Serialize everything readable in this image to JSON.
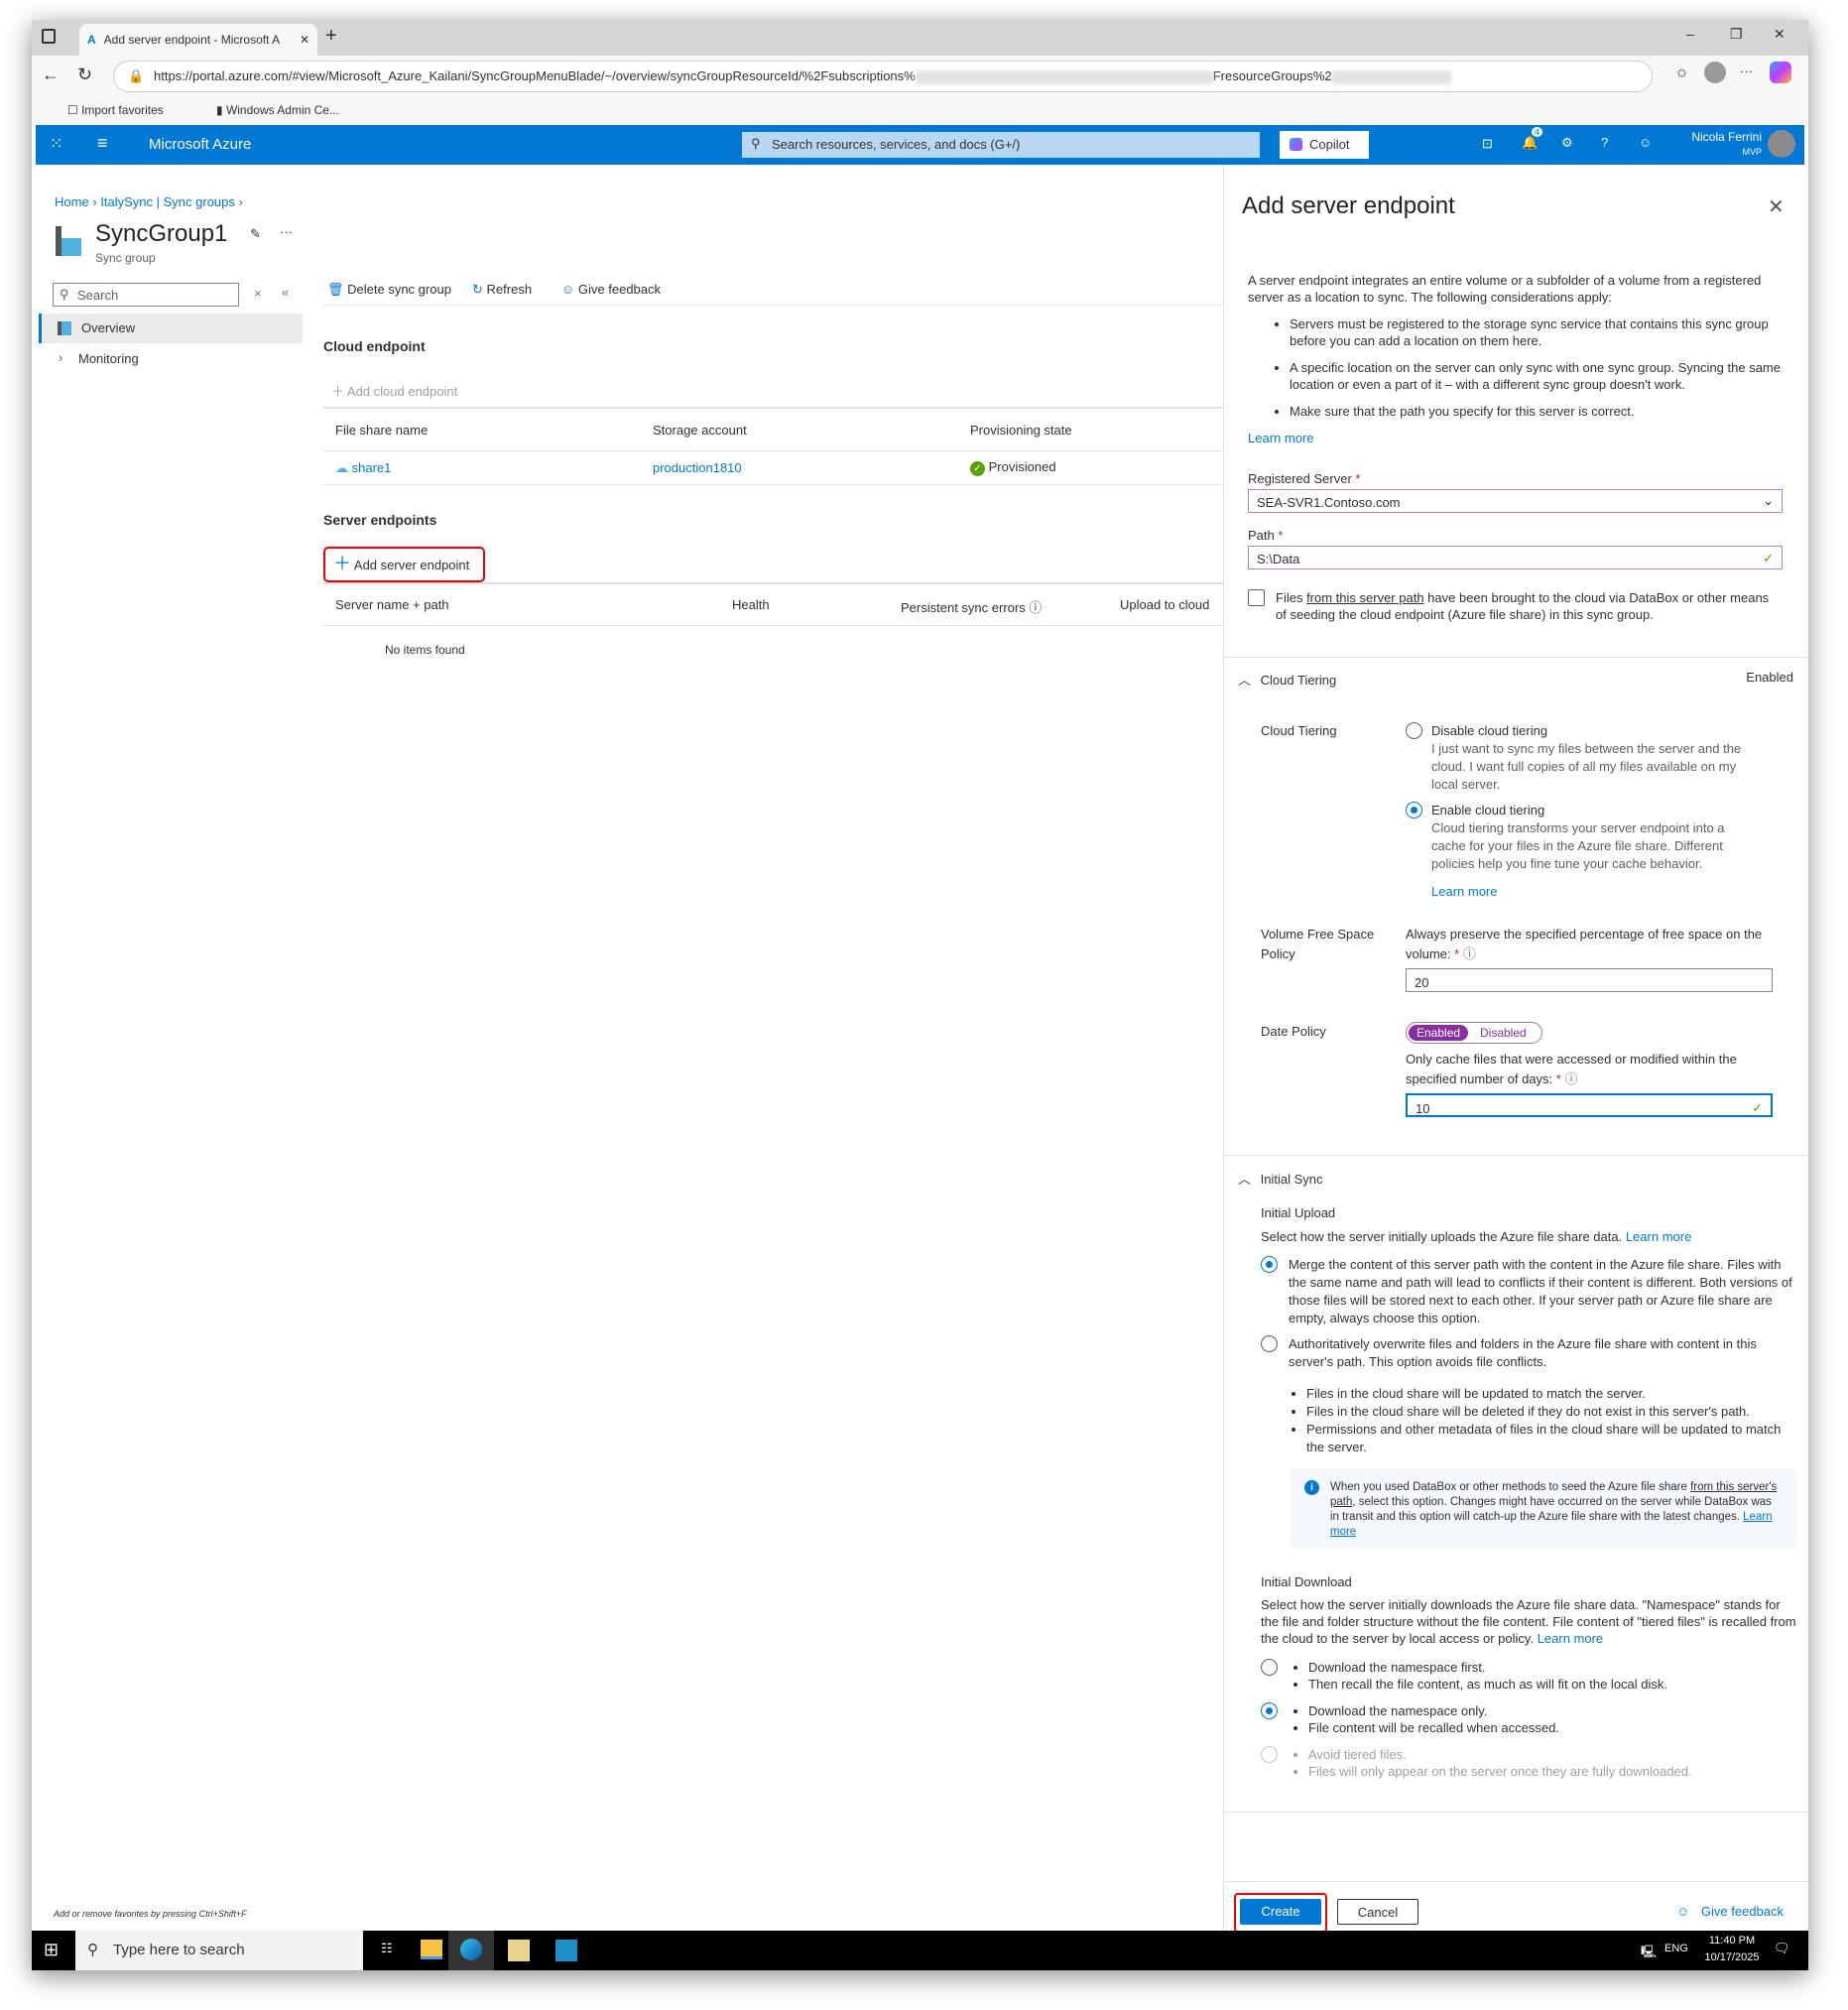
{
  "browser": {
    "tab_title": "Add server endpoint - Microsoft A",
    "url_start": "https://portal.azure.com/#view/Microsoft_Azure_Kailani/SyncGroupMenuBlade/~/overview/syncGroupResourceId/%2Fsubscriptions%",
    "url_mid": "FresourceGroups%2",
    "favorites": [
      "Import favorites",
      "Windows Admin Ce..."
    ]
  },
  "azure": {
    "brand": "Microsoft Azure",
    "search_placeholder": "Search resources, services, and docs (G+/)",
    "copilot": "Copilot",
    "notif_count": "4",
    "user_name": "Nicola Ferrini",
    "user_badge": "MVP"
  },
  "breadcrumb": [
    "Home",
    "ItalySync | Sync groups"
  ],
  "resource": {
    "title": "SyncGroup1",
    "subtitle": "Sync group"
  },
  "nav": {
    "search_placeholder": "Search",
    "items": [
      "Overview",
      "Monitoring"
    ]
  },
  "toolbar": {
    "delete": "Delete sync group",
    "refresh": "Refresh",
    "feedback": "Give feedback"
  },
  "cloud": {
    "heading": "Cloud endpoint",
    "add": "Add cloud endpoint",
    "columns": [
      "File share name",
      "Storage account",
      "Provisioning state"
    ],
    "rows": [
      {
        "share": "share1",
        "account": "production1810",
        "state": "Provisioned"
      }
    ]
  },
  "server": {
    "heading": "Server endpoints",
    "add": "Add server endpoint",
    "columns": [
      "Server name + path",
      "Health",
      "Persistent sync errors",
      "Upload to cloud"
    ],
    "empty": "No items found"
  },
  "panel": {
    "title": "Add server endpoint",
    "intro": "A server endpoint integrates an entire volume or a subfolder of a volume from a registered server as a location to sync. The following considerations apply:",
    "bullets": [
      "Servers must be registered to the storage sync service that contains this sync group before you can add a location on them here.",
      "A specific location on the server can only sync with one sync group. Syncing the same location or even a part of it – with a different sync group doesn't work.",
      "Make sure that the path you specify for this server is correct."
    ],
    "learn_more": "Learn more",
    "registered_server_label": "Registered Server",
    "registered_server_value": "SEA-SVR1.Contoso.com",
    "path_label": "Path",
    "path_value": "S:\\Data",
    "checkbox_pre": "Files ",
    "checkbox_link": "from this server path",
    "checkbox_post": " have been brought to the cloud via DataBox or other means of seeding the cloud endpoint (Azure file share) in this sync group.",
    "tiering": {
      "section": "Cloud Tiering",
      "status": "Enabled",
      "label": "Cloud Tiering",
      "disable_title": "Disable cloud tiering",
      "disable_desc": "I just want to sync my files between the server and the cloud. I want full copies of all my files available on my local server.",
      "enable_title": "Enable cloud tiering",
      "enable_desc": "Cloud tiering transforms your server endpoint into a cache for your files in the Azure file share. Different policies help you fine tune your cache behavior.",
      "learn_more": "Learn more",
      "vol_label": "Volume Free Space Policy",
      "vol_desc": "Always preserve the specified percentage of free space on the volume:",
      "vol_value": "20",
      "date_label": "Date Policy",
      "date_on": "Enabled",
      "date_off": "Disabled",
      "date_desc": "Only cache files that were accessed or modified within the specified number of days:",
      "date_value": "10"
    },
    "initial": {
      "section": "Initial Sync",
      "upload_title": "Initial Upload",
      "upload_desc": "Select how the server initially uploads the Azure file share data.",
      "learn_more": "Learn more",
      "merge": "Merge the content of this server path with the content in the Azure file share. Files with the same name and path will lead to conflicts if their content is different. Both versions of those files will be stored next to each other. If your server path or Azure file share are empty, always choose this option.",
      "overwrite": "Authoritatively overwrite files and folders in the Azure file share with content in this server's path. This option avoids file conflicts.",
      "overwrite_bullets": [
        "Files in the cloud share will be updated to match the server.",
        "Files in the cloud share will be deleted if they do not exist in this server's path.",
        "Permissions and other metadata of files in the cloud share will be updated to match the server."
      ],
      "info_pre": "When you used DataBox or other methods to seed the Azure file share ",
      "info_link": "from this server's path",
      "info_post": ", select this option. Changes might have occurred on the server while DataBox was in transit and this option will catch-up the Azure file share with the latest changes. ",
      "info_learn": "Learn more",
      "download_title": "Initial Download",
      "download_desc": "Select how the server initially downloads the Azure file share data. \"Namespace\" stands for the file and folder structure without the file content. File content of \"tiered files\" is recalled from the cloud to the server by local access or policy.",
      "opt1": [
        "Download the namespace first.",
        "Then recall the file content, as much as will fit on the local disk."
      ],
      "opt2": [
        "Download the namespace only.",
        "File content will be recalled when accessed."
      ],
      "opt3": [
        "Avoid tiered files.",
        "Files will only appear on the server once they are fully downloaded."
      ]
    },
    "create": "Create",
    "cancel": "Cancel",
    "feedback": "Give feedback"
  },
  "favorites_hint": "Add or remove favorites by pressing Ctrl+Shift+F",
  "taskbar": {
    "search": "Type here to search",
    "lang": "ENG",
    "time": "11:40 PM",
    "date": "10/17/2025"
  }
}
